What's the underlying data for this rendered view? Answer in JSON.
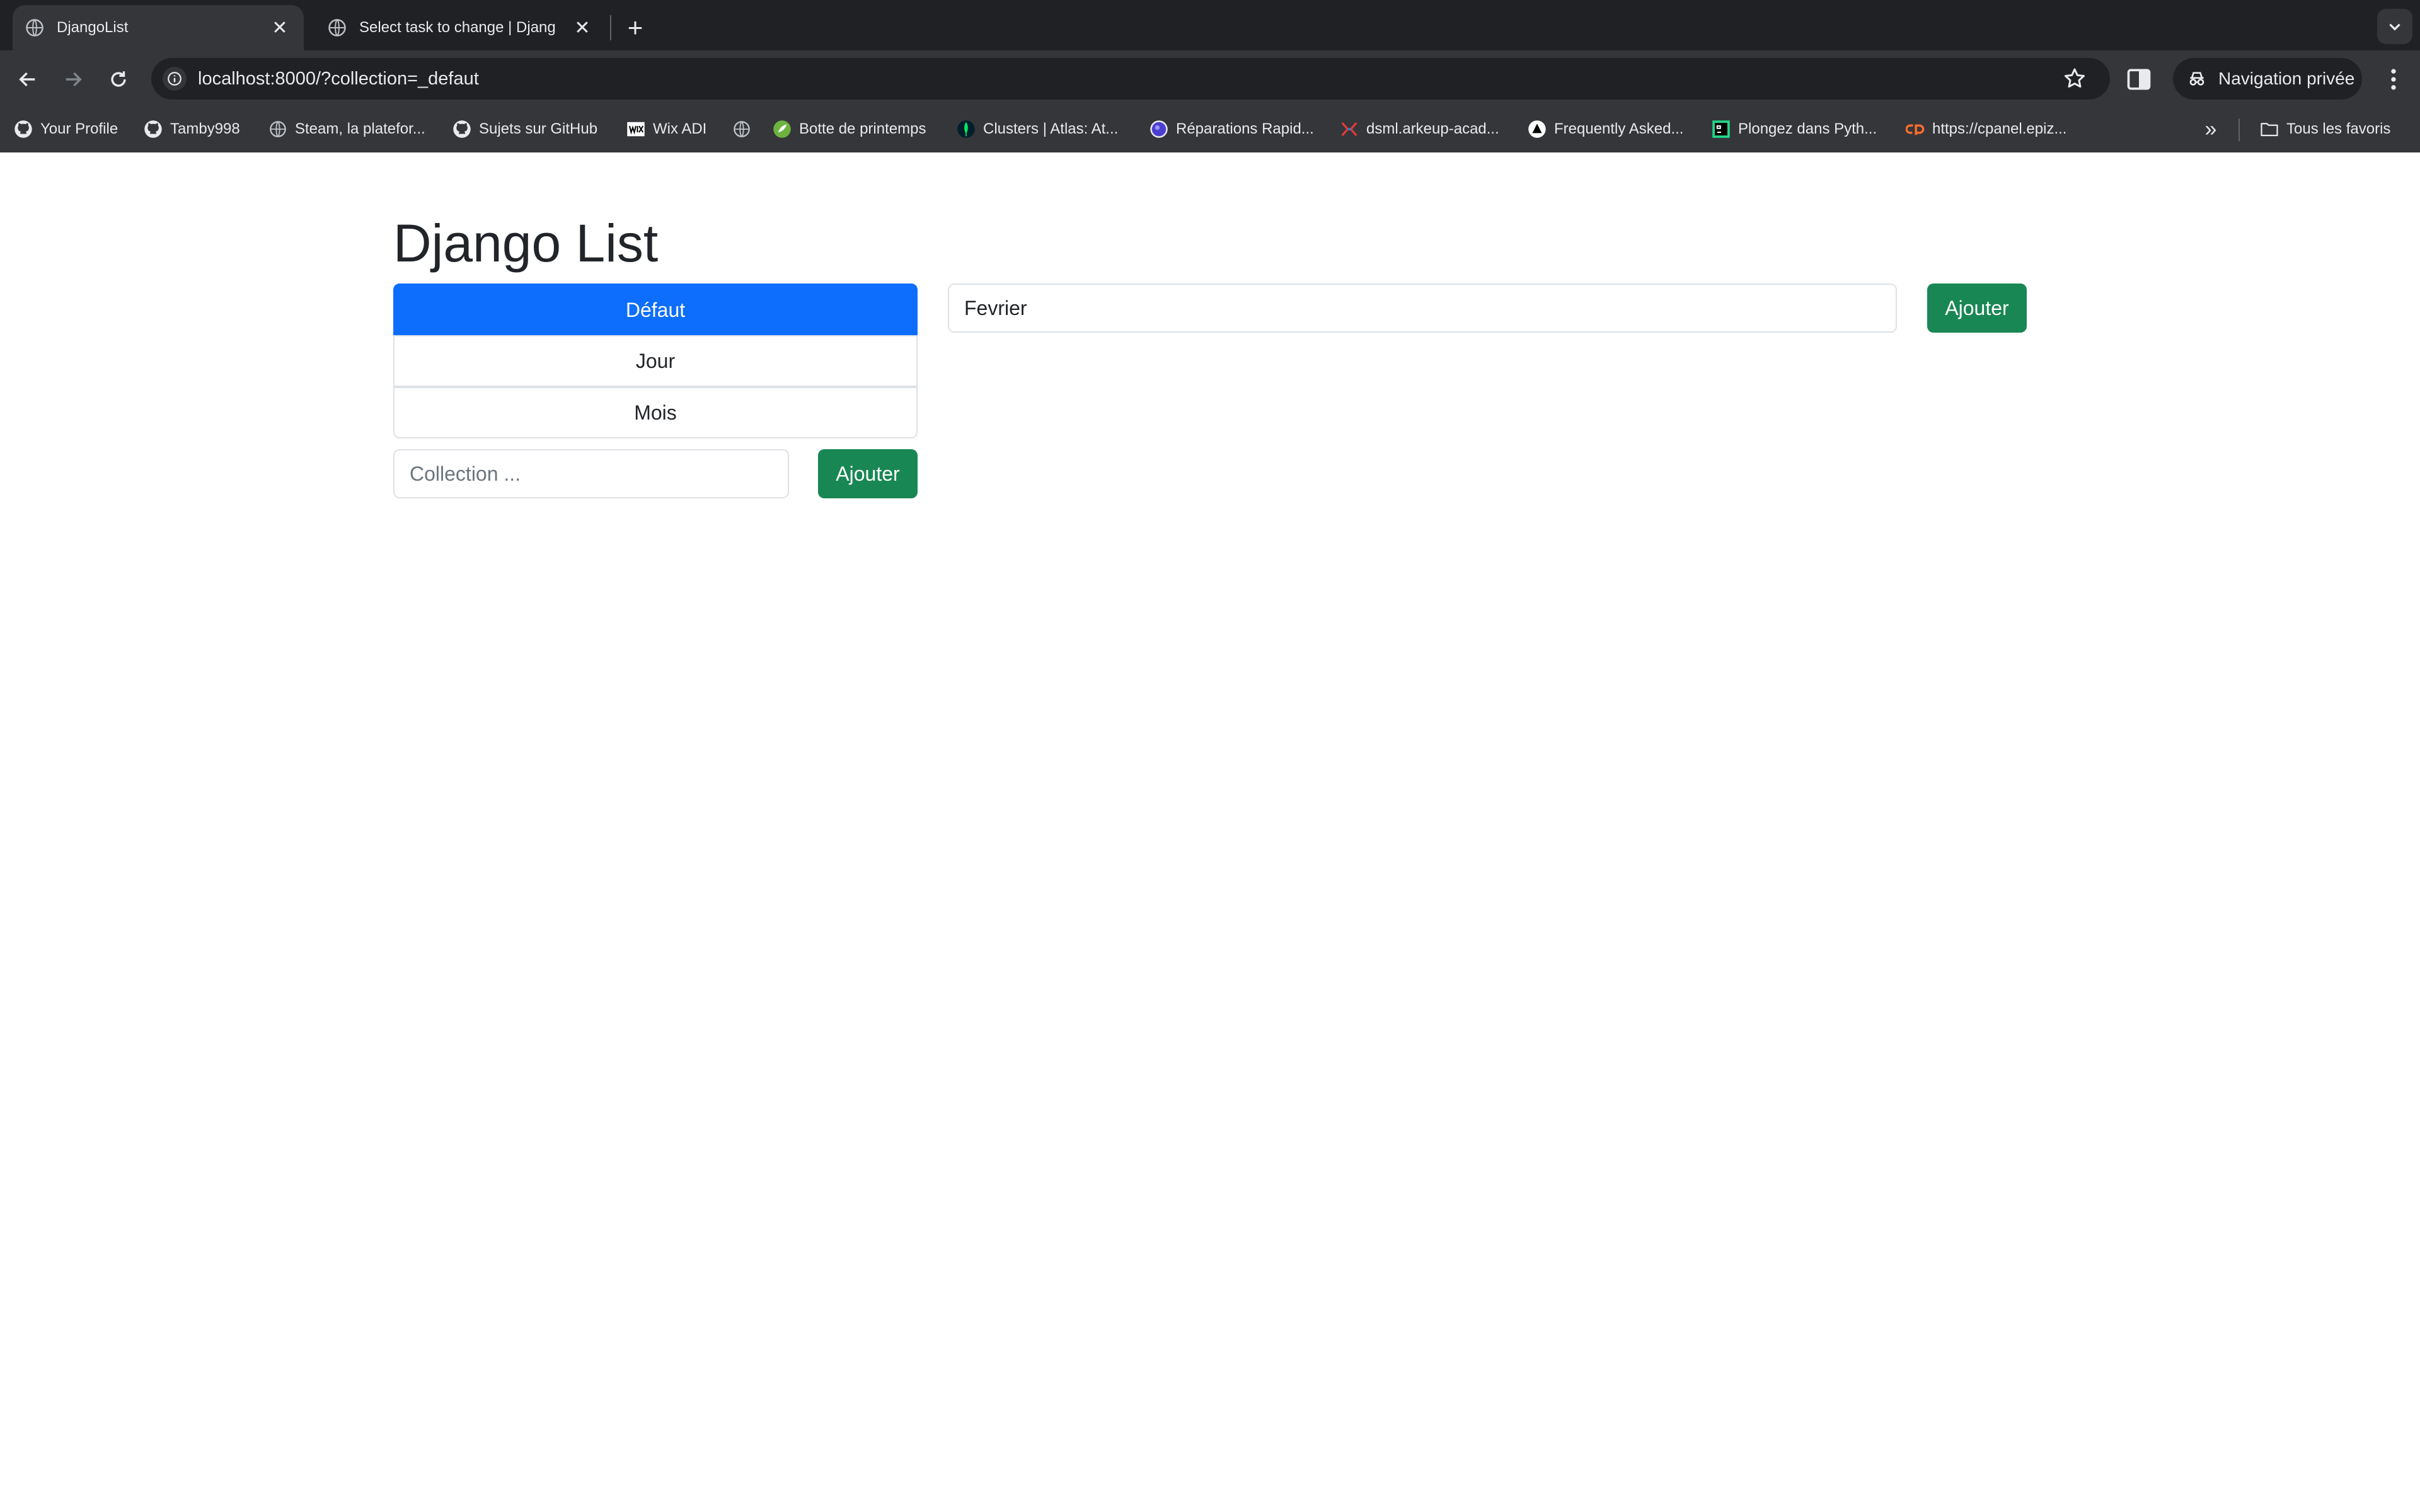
{
  "browser": {
    "tabs": [
      {
        "title": "DjangoList",
        "active": true
      },
      {
        "title": "Select task to change | Djang",
        "active": false
      }
    ],
    "url": "localhost:8000/?collection=_defaut",
    "incognito_label": "Navigation privée",
    "bookmarks": [
      {
        "label": "Your Profile",
        "icon": "github-icon"
      },
      {
        "label": "Tamby998",
        "icon": "github-icon"
      },
      {
        "label": "Steam, la platefor...",
        "icon": "globe-icon"
      },
      {
        "label": "Sujets sur GitHub",
        "icon": "github-icon"
      },
      {
        "label": "Wix ADI",
        "icon": "wix-icon"
      },
      {
        "label": "",
        "icon": "globe-icon"
      },
      {
        "label": "Botte de printemps",
        "icon": "spring-icon"
      },
      {
        "label": "Clusters | Atlas: At...",
        "icon": "mongodb-leaf-icon"
      },
      {
        "label": "Réparations Rapid...",
        "icon": "purple-orb-icon"
      },
      {
        "label": "dsml.arkeup-acad...",
        "icon": "arkeup-icon"
      },
      {
        "label": "Frequently Asked...",
        "icon": "triangle-logo-icon"
      },
      {
        "label": "Plongez dans Pyth...",
        "icon": "pycharm-icon"
      },
      {
        "label": "https://cpanel.epiz...",
        "icon": "cpanel-icon"
      }
    ],
    "all_bookmarks_label": "Tous les favoris"
  },
  "page": {
    "title": "Django List",
    "collections": [
      {
        "label": "Défaut",
        "active": true
      },
      {
        "label": "Jour",
        "active": false
      },
      {
        "label": "Mois",
        "active": false
      }
    ],
    "collection_form": {
      "placeholder": "Collection ...",
      "value": "",
      "button_label": "Ajouter"
    },
    "task_form": {
      "value": "Fevrier",
      "button_label": "Ajouter"
    }
  },
  "colors": {
    "primary": "#0d6efd",
    "success": "#198754",
    "chrome_dark": "#202124",
    "chrome_toolbar": "#35363a"
  }
}
